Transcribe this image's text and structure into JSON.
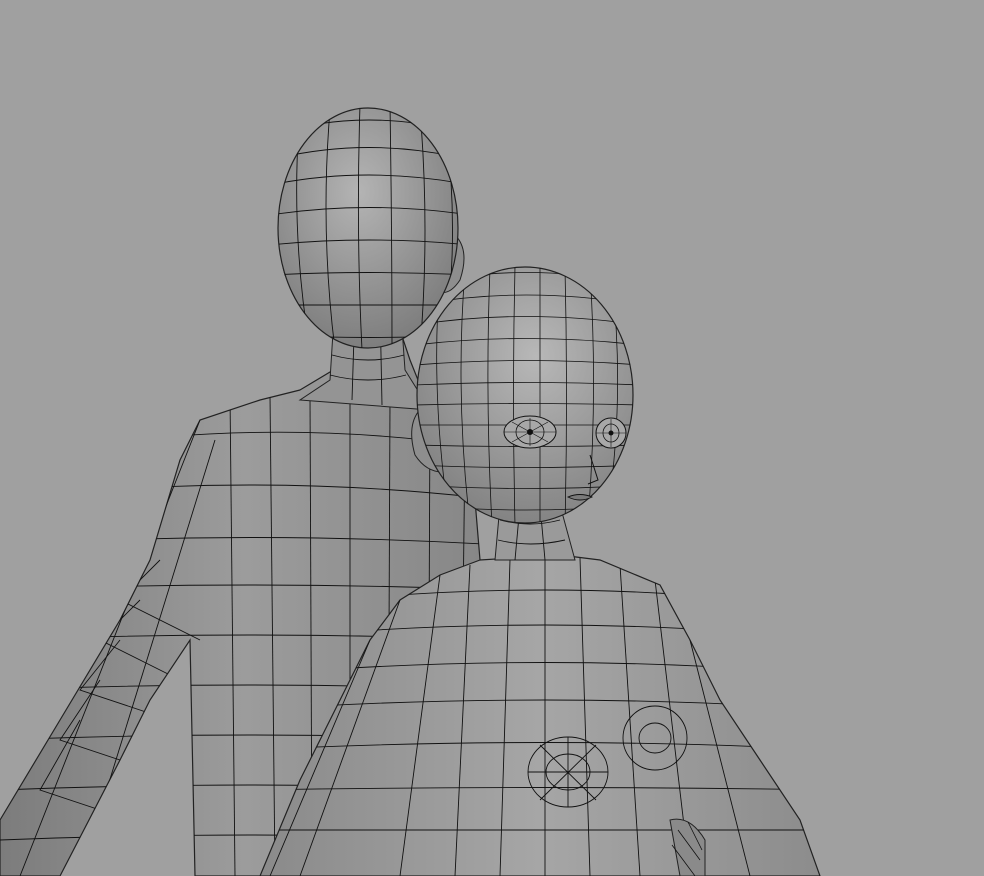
{
  "viewport": {
    "background_color": "#a0a0a0",
    "mesh_fill_color": "#8e8e8e",
    "mesh_shadow_color": "#6f6f6f",
    "wire_color": "#111111"
  },
  "scene": {
    "objects": [
      {
        "name": "male-base-mesh"
      },
      {
        "name": "female-base-mesh"
      }
    ]
  }
}
